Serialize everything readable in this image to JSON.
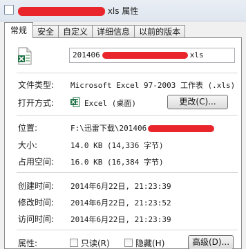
{
  "title_suffix": "xls 属性",
  "tabs": [
    "常规",
    "安全",
    "自定义",
    "详细信息",
    "以前的版本"
  ],
  "file": {
    "name_prefix": "201406",
    "name_suffix": "xls",
    "icon": "excel-file-icon"
  },
  "rows": {
    "file_type": {
      "label": "文件类型:",
      "value": "Microsoft Excel 97-2003 工作表 (.xls)"
    },
    "open_with": {
      "label": "打开方式:",
      "value": "Excel (桌面)",
      "button": "更改(C)..."
    },
    "location": {
      "label": "位置:",
      "value": "F:\\迅雷下载\\201406"
    },
    "size": {
      "label": "大小:",
      "value": "14.0 KB (14,336 字节)"
    },
    "size_on_disk": {
      "label": "占用空间:",
      "value": "16.0 KB (16,384 字节)"
    },
    "created": {
      "label": "创建时间:",
      "value": "2014年6月22日, 21:23:39"
    },
    "modified": {
      "label": "修改时间:",
      "value": "2014年6月22日, 21:23:52"
    },
    "accessed": {
      "label": "访问时间:",
      "value": "2014年6月22日, 21:23:39"
    }
  },
  "attributes": {
    "label": "属性:",
    "readonly": "只读(R)",
    "hidden": "隐藏(H)",
    "advanced_button": "高级(D)..."
  },
  "colors": {
    "redaction": "#e8262c",
    "excel_green": "#1e7145"
  }
}
